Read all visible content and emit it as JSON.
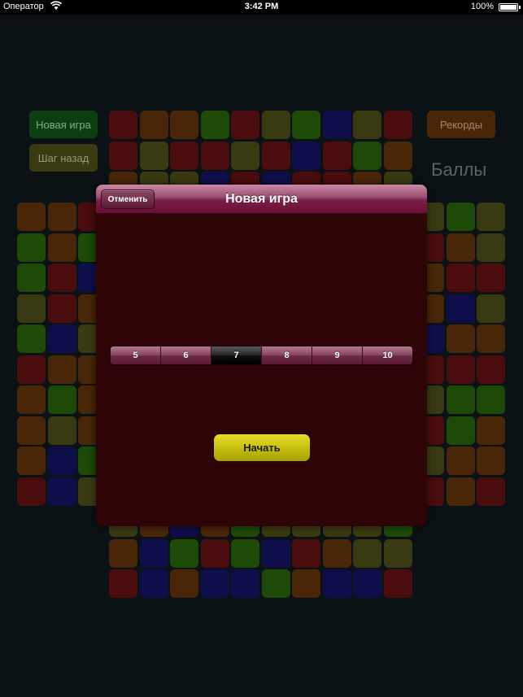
{
  "status_bar": {
    "carrier": "Оператор",
    "time": "3:42 PM",
    "battery": "100%"
  },
  "side": {
    "new_game": "Новая игра",
    "undo": "Шаг назад",
    "records": "Рекорды",
    "score_label": "Баллы"
  },
  "modal": {
    "title": "Новая игра",
    "cancel": "Отменить",
    "sizes": [
      "5",
      "6",
      "7",
      "8",
      "9",
      "10"
    ],
    "selected_size": "7",
    "start": "Начать"
  },
  "colors": {
    "red": "#4a0c0c",
    "orange": "#4a2608",
    "green": "#1e4a08",
    "olive": "#3a3a12",
    "blue": "#0e0e4a",
    "modal_bg": "#2e0407",
    "accent_yellow": "#d6d01a"
  },
  "board": {
    "grid_top": [
      [
        "red",
        "orange",
        "orange",
        "green",
        "red",
        "olive",
        "green",
        "blue",
        "olive",
        "red"
      ],
      [
        "red",
        "olive",
        "red",
        "red",
        "olive",
        "red",
        "blue",
        "red",
        "green",
        "orange"
      ],
      [
        "orange",
        "olive",
        "olive",
        "blue",
        "red",
        "blue",
        "red",
        "red",
        "orange",
        "olive"
      ]
    ],
    "grid_bottom": [
      [
        "olive",
        "orange",
        "blue",
        "orange",
        "green",
        "olive",
        "olive",
        "olive",
        "olive",
        "green"
      ],
      [
        "orange",
        "blue",
        "green",
        "red",
        "green",
        "blue",
        "red",
        "orange",
        "olive",
        "olive"
      ],
      [
        "red",
        "blue",
        "orange",
        "blue",
        "blue",
        "green",
        "orange",
        "blue",
        "blue",
        "red"
      ]
    ],
    "left_cols": [
      [
        "orange",
        "orange",
        "red"
      ],
      [
        "green",
        "orange",
        "green"
      ],
      [
        "green",
        "red",
        "blue"
      ],
      [
        "olive",
        "red",
        "orange"
      ],
      [
        "green",
        "blue",
        "olive"
      ],
      [
        "red",
        "orange",
        "orange"
      ],
      [
        "orange",
        "green",
        "orange"
      ],
      [
        "orange",
        "olive",
        "orange"
      ],
      [
        "orange",
        "blue",
        "green"
      ],
      [
        "red",
        "blue",
        "olive"
      ]
    ],
    "right_cols": [
      [
        "olive",
        "green",
        "olive"
      ],
      [
        "red",
        "orange",
        "olive"
      ],
      [
        "orange",
        "red",
        "red"
      ],
      [
        "orange",
        "blue",
        "olive"
      ],
      [
        "blue",
        "orange",
        "orange"
      ],
      [
        "red",
        "red",
        "red"
      ],
      [
        "olive",
        "green",
        "green"
      ],
      [
        "red",
        "green",
        "orange"
      ],
      [
        "olive",
        "orange",
        "orange"
      ],
      [
        "red",
        "orange",
        "red"
      ]
    ]
  }
}
